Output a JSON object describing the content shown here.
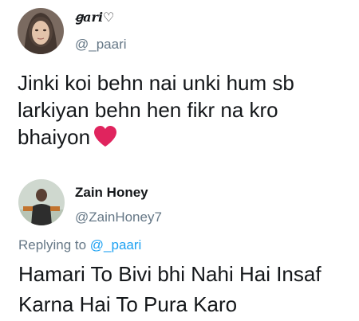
{
  "tweet1": {
    "display_name": "ꞡari♡",
    "handle": "@_paari",
    "text": "Jinki koi behn nai unki hum sb larkiyan behn hen fikr na kro bhaiyon",
    "emoji": "red-heart-icon"
  },
  "reply": {
    "display_name": "Zain Honey",
    "handle": "@ZainHoney7",
    "replying_to_label": "Replying to",
    "replying_to_handle": "@_paari",
    "text": "Hamari To Bivi bhi Nahi Hai Insaf Karna Hai To Pura Karo"
  },
  "colors": {
    "primary_text": "#14171a",
    "secondary_text": "#657786",
    "link": "#1da1f2",
    "heart": "#e0245e"
  }
}
